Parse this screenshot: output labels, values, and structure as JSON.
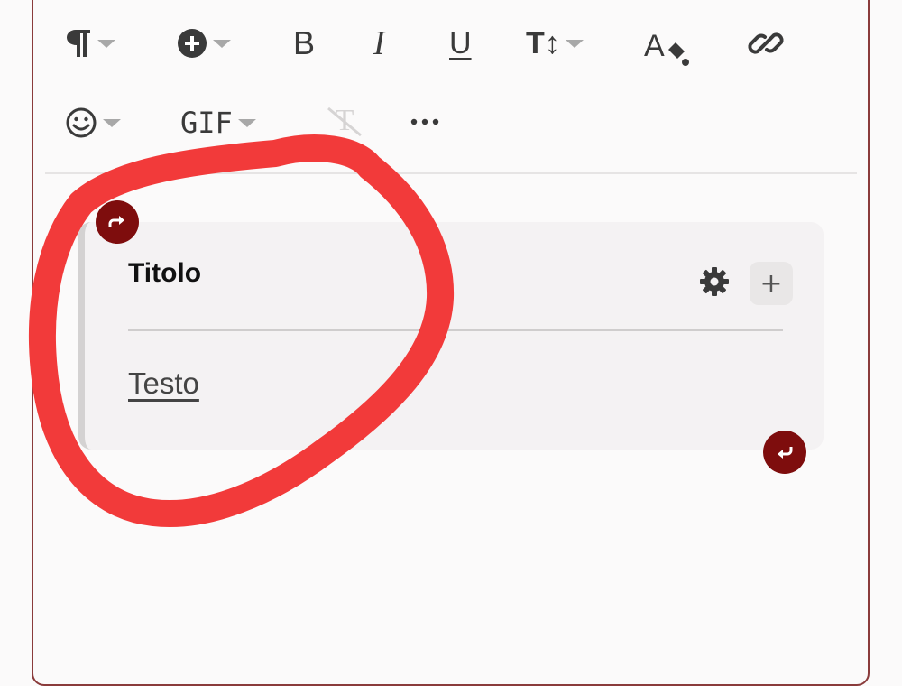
{
  "toolbar": {
    "row1": [
      {
        "name": "paragraph-format",
        "icon": "pilcrow-icon",
        "has_dropdown": true
      },
      {
        "name": "insert",
        "icon": "plus-circle-icon",
        "has_dropdown": true
      },
      {
        "name": "bold",
        "icon": "bold-icon",
        "label": "B"
      },
      {
        "name": "italic",
        "icon": "italic-icon",
        "label": "I"
      },
      {
        "name": "underline",
        "icon": "underline-icon",
        "label": "U"
      },
      {
        "name": "text-size",
        "icon": "text-size-icon",
        "label": "T↕",
        "has_dropdown": true
      },
      {
        "name": "text-color",
        "icon": "text-color-icon",
        "label": "A"
      },
      {
        "name": "link",
        "icon": "link-icon"
      }
    ],
    "row2": [
      {
        "name": "emoji",
        "icon": "smiley-icon",
        "has_dropdown": true
      },
      {
        "name": "gif",
        "label": "GIF",
        "has_dropdown": true
      },
      {
        "name": "clear-format",
        "icon": "clear-format-icon",
        "label": "T",
        "disabled": true
      },
      {
        "name": "more",
        "icon": "ellipsis-icon"
      }
    ]
  },
  "block": {
    "title": "Titolo",
    "text": "Testo",
    "settings_icon": "gear-icon",
    "add_label": "+"
  },
  "colors": {
    "accent": "#7e0d0d",
    "annotation": "#f23a3a",
    "block_bg": "#f4f2f3"
  }
}
